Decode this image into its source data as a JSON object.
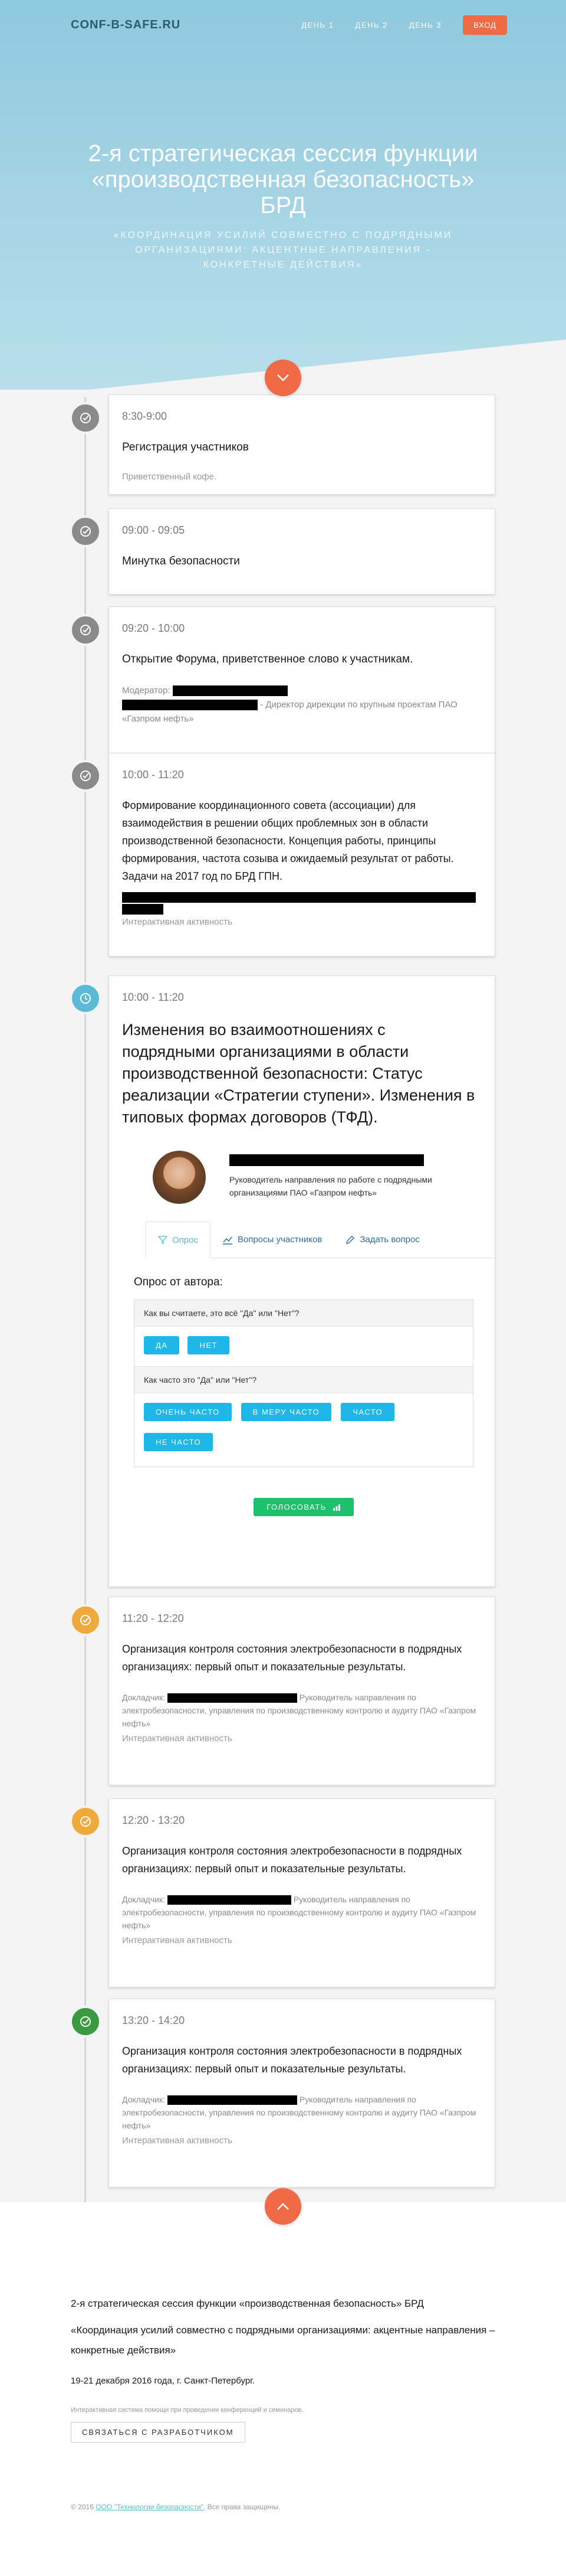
{
  "nav": {
    "logo": "CONF-B-SAFE.RU",
    "links": [
      "ДЕНЬ 1",
      "ДЕНЬ 2",
      "ДЕНЬ 3"
    ],
    "login": "ВХОД"
  },
  "hero": {
    "title": "2-я стратегическая сессия функции «производственная безопасность» БРД",
    "subtitle": "«Координация усилий совместно с подрядными организациями: акцентные направления - конкретные действия»"
  },
  "colors": {
    "accent": "#ef6a45",
    "icon_gray": "#8a8a8a",
    "icon_blue": "#5bbbd6",
    "icon_orange": "#f0a93b",
    "icon_green": "#3a9a3f",
    "poll_button": "#1fb6e8",
    "vote_button": "#1ec16b"
  },
  "events": [
    {
      "icon": "check-icon",
      "time": "8:30-9:00",
      "title": "Регистрация участников",
      "note": "Приветственный кофе."
    },
    {
      "icon": "check-icon",
      "time": "09:00 - 09:05",
      "title": "Минутка безопасности"
    },
    {
      "icon": "check-icon",
      "time": "09:20 - 10:00",
      "title": "Открытие Форума, приветственное слово к участникам.",
      "moderator_label": "Модератор:",
      "moderator_role": "- Директор дирекции по крупным проектам ПАО «Газпром нефть»"
    },
    {
      "icon": "check-icon",
      "time": "10:00 - 11:20",
      "title": "Формирование координационного совета (ассоциации) для взаимодействия в решении общих проблемных зон в области производственной безопасности. Концепция работы, принципы формирования, частота созыва и ожидаемый результат от работы. Задачи на 2017 год по БРД ГПН.",
      "activity": "Интерактивная активность"
    },
    {
      "icon": "clock-icon",
      "time": "10:00 - 11:20",
      "title": "Изменения во взаимоотношениях с подрядными организациями в области производственной безопасности: Статус реализации «Стратегии ступени». Изменения в типовых формах договоров (ТФД).",
      "speaker_role": "Руководитель направления по работе с подрядными организациями ПАО «Газпром нефть»"
    },
    {
      "icon": "check-icon",
      "time": "11:20 - 12:20",
      "title": "Организация  контроля состояния электробезопасности в подрядных организациях: первый опыт и показательные результаты.",
      "speaker_label": "Докладчик:",
      "speaker_role": "Руководитель направления по электробезопасности, управления по производственному контролю и аудиту ПАО «Газпром нефть»",
      "activity": "Интерактивная активность"
    },
    {
      "icon": "check-icon",
      "time": "12:20 - 13:20",
      "title": "Организация  контроля состояния электробезопасности в подрядных организациях: первый опыт и показательные результаты.",
      "speaker_label": "Докладчик:",
      "speaker_role": "Руководитель направления по электробезопасности, управления по производственному контролю и аудиту ПАО «Газпром нефть»",
      "activity": "Интерактивная активность"
    },
    {
      "icon": "check-icon",
      "time": "13:20 - 14:20",
      "title": "Организация  контроля состояния электробезопасности в подрядных организациях: первый опыт и показательные результаты.",
      "speaker_label": "Докладчик:",
      "speaker_role": "Руководитель направления по электробезопасности, управления по производственному контролю и аудиту ПАО «Газпром нефть»",
      "activity": "Интерактивная активность"
    }
  ],
  "tabs": {
    "poll": "Опрос",
    "questions": "Вопросы участников",
    "ask": "Задать вопрос"
  },
  "poll": {
    "heading": "Опрос от автора:",
    "q1": "Как вы считаете, это всё \"Да\" или \"Нет\"?",
    "q1_options": [
      "ДА",
      "НЕТ"
    ],
    "q2": "Как часто это \"Да\" или \"Нет\"?",
    "q2_options": [
      "ОЧЕНЬ ЧАСТО",
      "В МЕРУ ЧАСТО",
      "ЧАСТО",
      "НЕ ЧАСТО"
    ],
    "vote": "ГОЛОСОВАТЬ"
  },
  "footer": {
    "title": "2-я стратегическая сессия функции «производственная безопасность» БРД",
    "subtitle": "«Координация усилий совместно с подрядными организациями: акцентные направления – конкретные действия»",
    "date": "19-21 декабря 2016 года, г. Санкт-Петербург.",
    "system": "Интерактивная система помощи при проведении конференций и семинаров.",
    "dev_button": "СВЯЗАТЬСЯ С РАЗРАБОТЧИКОМ",
    "copy_prefix": "© 2016",
    "copy_link": "ООО \"Технологии безопасности\"",
    "copy_suffix": ". Все права защищены."
  }
}
